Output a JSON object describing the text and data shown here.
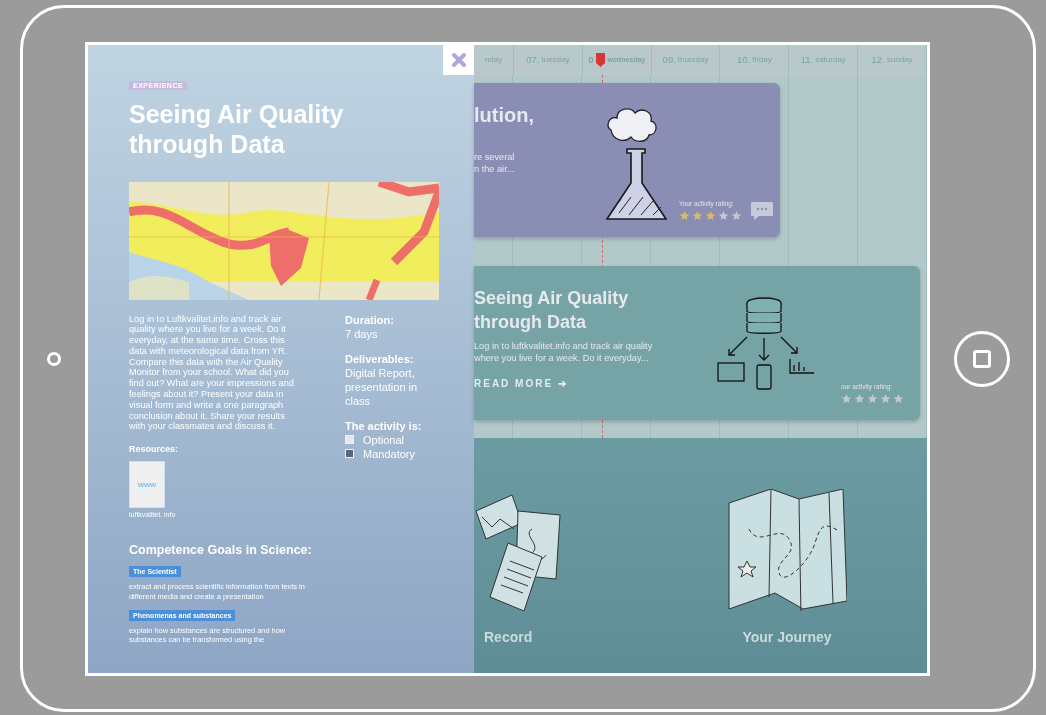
{
  "panel": {
    "tag": "EXPERIENCE",
    "title": "Seeing Air Quality through Data",
    "description": "Log in to Luftkvalitet.info and track air quality where you live for a week. Do it everyday, at the same time. Cross this data with meteorological data from YR. Compare this data with the Air Quality Monitor from your school. What did you find out? What are your impressions and feelings about it? Present your data in visual form and write a one paragraph conclusion about it. Share your results with your classmates and discuss it.",
    "details": [
      {
        "label": "Duration:",
        "value": "7 days"
      },
      {
        "label": "Deliverables:",
        "value": "Digital Report, presentation in class"
      }
    ],
    "activity": {
      "label": "The activity is:",
      "options": [
        {
          "label": "Optional",
          "checked": false
        },
        {
          "label": "Mandatory",
          "checked": true
        }
      ]
    },
    "resources_label": "Resources:",
    "resources": [
      {
        "thumb": "www",
        "caption": "luftkvalitet. info"
      }
    ],
    "goals_heading": "Competence Goals in Science:",
    "goals": [
      {
        "tag": "The Scientist",
        "text": "extract and process scientific information from texts in different media and create a presentation"
      },
      {
        "tag": "Phenomenas and substances",
        "text": "explain how substances are structured and how substances can be transformed using the"
      }
    ]
  },
  "days": [
    {
      "name": "nday",
      "today": false
    },
    {
      "number": "07.",
      "name": "tuesday",
      "today": false
    },
    {
      "number": "0",
      "name": "wednesday",
      "today": true
    },
    {
      "number": "09.",
      "name": "thursday",
      "today": false
    },
    {
      "number": "10.",
      "name": "friday",
      "today": false
    },
    {
      "number": "11.",
      "name": "saturday",
      "today": false
    },
    {
      "number": "12.",
      "name": "sunday",
      "today": false
    }
  ],
  "cards": [
    {
      "kind": "flask",
      "color": "#8b8eb4",
      "title": "lution,",
      "lines": [
        "re several",
        "n the air..."
      ],
      "rating_label": "Your activity rating:",
      "stars": 3,
      "chat": true
    },
    {
      "kind": "database",
      "color": "#76a4a6",
      "title": "Seeing Air Quality through Data",
      "lines": [
        "Log in to luftkvalitet.info and track air quality",
        "where you live for a week. Do it everyday..."
      ],
      "link": "READ MORE ➔",
      "rating_label": "our activity rating:",
      "stars": 0,
      "chat": false
    }
  ],
  "sections": [
    {
      "kind": "record",
      "label": "Record"
    },
    {
      "kind": "journey",
      "label": "Your Journey"
    }
  ]
}
